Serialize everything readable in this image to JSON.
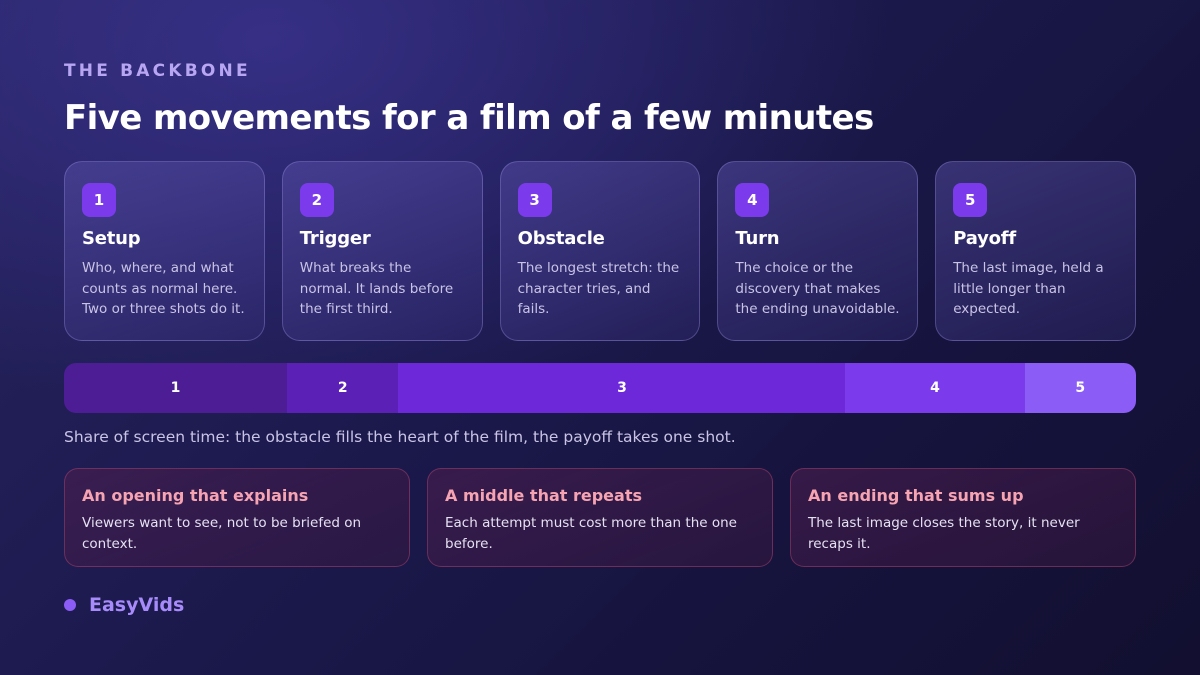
{
  "eyebrow": "THE BACKBONE",
  "title": "Five movements for a film of a few minutes",
  "steps": [
    {
      "number": "1",
      "title": "Setup",
      "description": "Who, where, and what counts as normal here. Two or three shots do it."
    },
    {
      "number": "2",
      "title": "Trigger",
      "description": "What breaks the normal. It lands before the first third."
    },
    {
      "number": "3",
      "title": "Obstacle",
      "description": "The longest stretch: the character tries, and fails."
    },
    {
      "number": "4",
      "title": "Turn",
      "description": "The choice or the discovery that makes the ending unavoidable."
    },
    {
      "number": "5",
      "title": "Payoff",
      "description": "The last image, held a little longer than expected."
    }
  ],
  "timeline": {
    "segments": [
      {
        "label": "1",
        "share": 0.208,
        "color": "#4c1d95"
      },
      {
        "label": "2",
        "share": 0.104,
        "color": "#5b21b6"
      },
      {
        "label": "3",
        "share": 0.417,
        "color": "#6d28d9"
      },
      {
        "label": "4",
        "share": 0.167,
        "color": "#7c3aed"
      },
      {
        "label": "5",
        "share": 0.104,
        "color": "#8b5cf6"
      }
    ],
    "caption": "Share of screen time: the obstacle fills the heart of the film, the payoff takes one shot."
  },
  "pitfalls": [
    {
      "title": "An opening that explains",
      "description": "Viewers want to see, not to be briefed on context."
    },
    {
      "title": "A middle that repeats",
      "description": "Each attempt must cost more than the one before."
    },
    {
      "title": "An ending that sums up",
      "description": "The last image closes the story, it never recaps it."
    }
  ],
  "brand": {
    "name": "EasyVids",
    "accent": "#8b5cf6"
  }
}
